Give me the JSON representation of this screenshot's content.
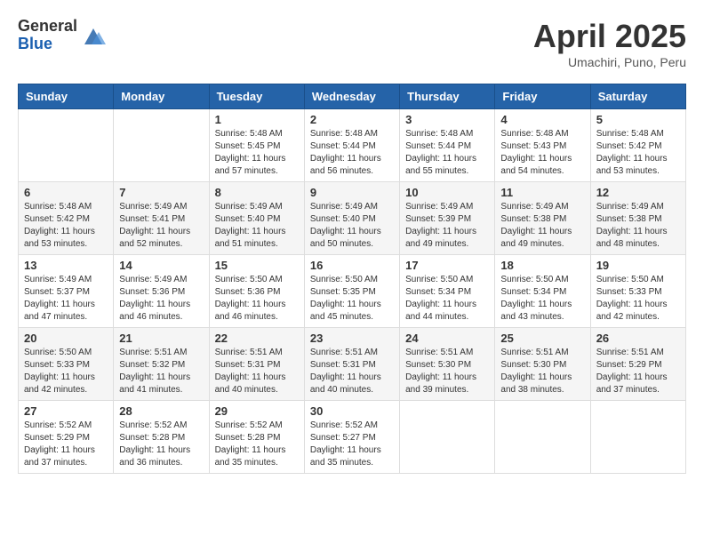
{
  "header": {
    "logo_general": "General",
    "logo_blue": "Blue",
    "month_title": "April 2025",
    "location": "Umachiri, Puno, Peru"
  },
  "weekdays": [
    "Sunday",
    "Monday",
    "Tuesday",
    "Wednesday",
    "Thursday",
    "Friday",
    "Saturday"
  ],
  "weeks": [
    [
      {
        "day": "",
        "info": ""
      },
      {
        "day": "",
        "info": ""
      },
      {
        "day": "1",
        "info": "Sunrise: 5:48 AM\nSunset: 5:45 PM\nDaylight: 11 hours\nand 57 minutes."
      },
      {
        "day": "2",
        "info": "Sunrise: 5:48 AM\nSunset: 5:44 PM\nDaylight: 11 hours\nand 56 minutes."
      },
      {
        "day": "3",
        "info": "Sunrise: 5:48 AM\nSunset: 5:44 PM\nDaylight: 11 hours\nand 55 minutes."
      },
      {
        "day": "4",
        "info": "Sunrise: 5:48 AM\nSunset: 5:43 PM\nDaylight: 11 hours\nand 54 minutes."
      },
      {
        "day": "5",
        "info": "Sunrise: 5:48 AM\nSunset: 5:42 PM\nDaylight: 11 hours\nand 53 minutes."
      }
    ],
    [
      {
        "day": "6",
        "info": "Sunrise: 5:48 AM\nSunset: 5:42 PM\nDaylight: 11 hours\nand 53 minutes."
      },
      {
        "day": "7",
        "info": "Sunrise: 5:49 AM\nSunset: 5:41 PM\nDaylight: 11 hours\nand 52 minutes."
      },
      {
        "day": "8",
        "info": "Sunrise: 5:49 AM\nSunset: 5:40 PM\nDaylight: 11 hours\nand 51 minutes."
      },
      {
        "day": "9",
        "info": "Sunrise: 5:49 AM\nSunset: 5:40 PM\nDaylight: 11 hours\nand 50 minutes."
      },
      {
        "day": "10",
        "info": "Sunrise: 5:49 AM\nSunset: 5:39 PM\nDaylight: 11 hours\nand 49 minutes."
      },
      {
        "day": "11",
        "info": "Sunrise: 5:49 AM\nSunset: 5:38 PM\nDaylight: 11 hours\nand 49 minutes."
      },
      {
        "day": "12",
        "info": "Sunrise: 5:49 AM\nSunset: 5:38 PM\nDaylight: 11 hours\nand 48 minutes."
      }
    ],
    [
      {
        "day": "13",
        "info": "Sunrise: 5:49 AM\nSunset: 5:37 PM\nDaylight: 11 hours\nand 47 minutes."
      },
      {
        "day": "14",
        "info": "Sunrise: 5:49 AM\nSunset: 5:36 PM\nDaylight: 11 hours\nand 46 minutes."
      },
      {
        "day": "15",
        "info": "Sunrise: 5:50 AM\nSunset: 5:36 PM\nDaylight: 11 hours\nand 46 minutes."
      },
      {
        "day": "16",
        "info": "Sunrise: 5:50 AM\nSunset: 5:35 PM\nDaylight: 11 hours\nand 45 minutes."
      },
      {
        "day": "17",
        "info": "Sunrise: 5:50 AM\nSunset: 5:34 PM\nDaylight: 11 hours\nand 44 minutes."
      },
      {
        "day": "18",
        "info": "Sunrise: 5:50 AM\nSunset: 5:34 PM\nDaylight: 11 hours\nand 43 minutes."
      },
      {
        "day": "19",
        "info": "Sunrise: 5:50 AM\nSunset: 5:33 PM\nDaylight: 11 hours\nand 42 minutes."
      }
    ],
    [
      {
        "day": "20",
        "info": "Sunrise: 5:50 AM\nSunset: 5:33 PM\nDaylight: 11 hours\nand 42 minutes."
      },
      {
        "day": "21",
        "info": "Sunrise: 5:51 AM\nSunset: 5:32 PM\nDaylight: 11 hours\nand 41 minutes."
      },
      {
        "day": "22",
        "info": "Sunrise: 5:51 AM\nSunset: 5:31 PM\nDaylight: 11 hours\nand 40 minutes."
      },
      {
        "day": "23",
        "info": "Sunrise: 5:51 AM\nSunset: 5:31 PM\nDaylight: 11 hours\nand 40 minutes."
      },
      {
        "day": "24",
        "info": "Sunrise: 5:51 AM\nSunset: 5:30 PM\nDaylight: 11 hours\nand 39 minutes."
      },
      {
        "day": "25",
        "info": "Sunrise: 5:51 AM\nSunset: 5:30 PM\nDaylight: 11 hours\nand 38 minutes."
      },
      {
        "day": "26",
        "info": "Sunrise: 5:51 AM\nSunset: 5:29 PM\nDaylight: 11 hours\nand 37 minutes."
      }
    ],
    [
      {
        "day": "27",
        "info": "Sunrise: 5:52 AM\nSunset: 5:29 PM\nDaylight: 11 hours\nand 37 minutes."
      },
      {
        "day": "28",
        "info": "Sunrise: 5:52 AM\nSunset: 5:28 PM\nDaylight: 11 hours\nand 36 minutes."
      },
      {
        "day": "29",
        "info": "Sunrise: 5:52 AM\nSunset: 5:28 PM\nDaylight: 11 hours\nand 35 minutes."
      },
      {
        "day": "30",
        "info": "Sunrise: 5:52 AM\nSunset: 5:27 PM\nDaylight: 11 hours\nand 35 minutes."
      },
      {
        "day": "",
        "info": ""
      },
      {
        "day": "",
        "info": ""
      },
      {
        "day": "",
        "info": ""
      }
    ]
  ]
}
